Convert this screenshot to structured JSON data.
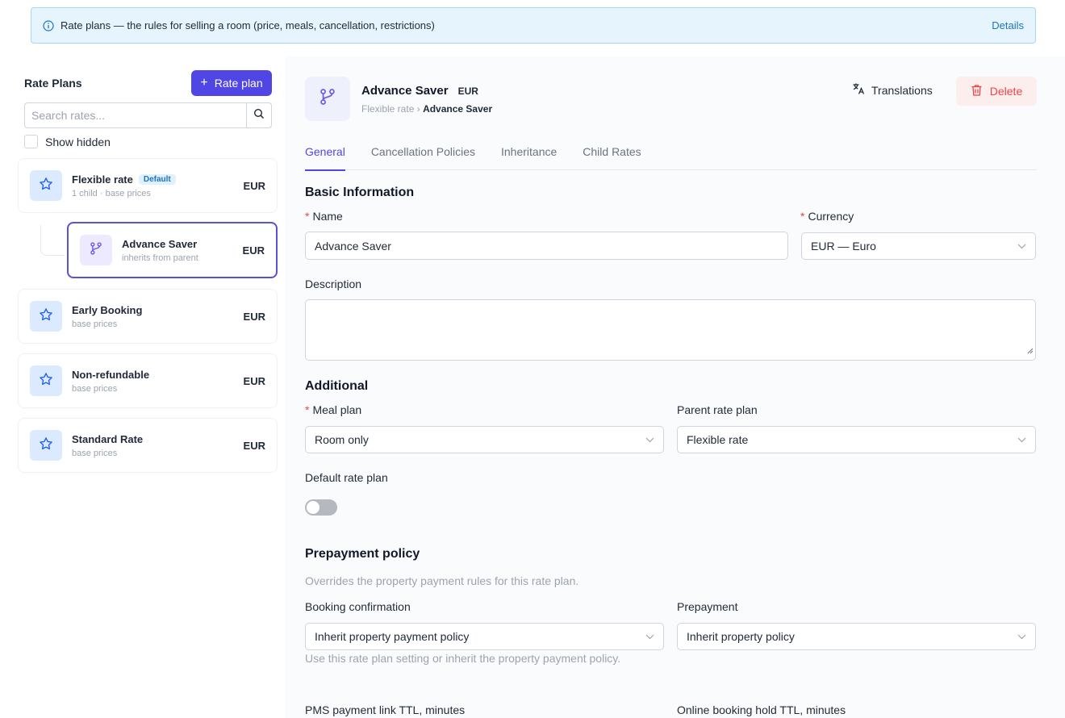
{
  "banner": {
    "text": "Rate plans — the rules for selling a room (price, meals, cancellation, restrictions)",
    "details_label": "Details"
  },
  "sidebar": {
    "title": "Rate Plans",
    "add_button_label": "Rate plan",
    "search_placeholder": "Search rates...",
    "show_hidden_label": "Show hidden",
    "plans": [
      {
        "name": "Flexible rate",
        "badge": "Default",
        "sub": "1 child · base prices",
        "currency": "EUR",
        "icon": "star-icon"
      },
      {
        "name": "Advance Saver",
        "sub": "inherits from parent",
        "currency": "EUR",
        "icon": "branch-icon",
        "selected": true
      },
      {
        "name": "Early Booking",
        "sub": "base prices",
        "currency": "EUR",
        "icon": "star-icon"
      },
      {
        "name": "Non-refundable",
        "sub": "base prices",
        "currency": "EUR",
        "icon": "star-icon"
      },
      {
        "name": "Standard Rate",
        "sub": "base prices",
        "currency": "EUR",
        "icon": "star-icon"
      }
    ]
  },
  "header": {
    "title": "Advance Saver",
    "currency": "EUR",
    "breadcrumb_parent": "Flexible rate",
    "breadcrumb_sep": "›",
    "breadcrumb_current": "Advance Saver",
    "translations_label": "Translations",
    "delete_label": "Delete"
  },
  "tabs": [
    "General",
    "Cancellation Policies",
    "Inheritance",
    "Child Rates"
  ],
  "form": {
    "basic_title": "Basic Information",
    "name_label": "Name",
    "name_value": "Advance Saver",
    "currency_label": "Currency",
    "currency_value": "EUR — Euro",
    "description_label": "Description",
    "additional_title": "Additional",
    "meal_plan_label": "Meal plan",
    "meal_plan_value": "Room only",
    "parent_label": "Parent rate plan",
    "parent_value": "Flexible rate",
    "default_label": "Default rate plan",
    "default_on": false,
    "prepayment_title": "Prepayment policy",
    "prepayment_desc": "Overrides the property payment rules for this rate plan.",
    "booking_conf_label": "Booking confirmation",
    "booking_conf_value": "Inherit property payment policy",
    "booking_conf_help": "Use this rate plan setting or inherit the property payment policy.",
    "prepayment_label": "Prepayment",
    "prepayment_value": "Inherit property policy",
    "pms_ttl_label": "PMS payment link TTL, minutes",
    "online_ttl_label": "Online booking hold TTL, minutes"
  },
  "colors": {
    "accent": "#4f46e5",
    "banner_bg": "#e6f4fd",
    "danger": "#ef4444"
  }
}
